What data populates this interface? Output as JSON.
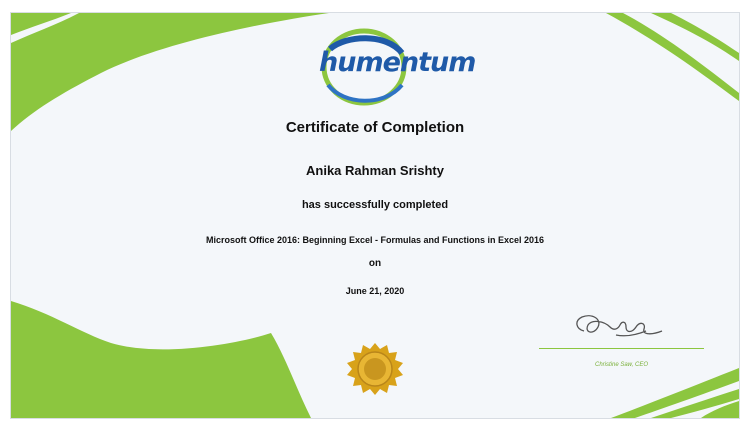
{
  "certificate": {
    "title": "Certificate of Completion",
    "recipient": "Anika Rahman Srishty",
    "completed_text": "has successfully completed",
    "course": "Microsoft Office 2016: Beginning Excel - Formulas and Functions in Excel 2016",
    "on_text": "on",
    "date": "June 21, 2020",
    "signer": "Christine Saw, CEO"
  },
  "logo": {
    "text": "humentum"
  },
  "colors": {
    "accent_green": "#8cc63f",
    "logo_blue": "#1f5aa8",
    "seal_gold": "#d8a21a",
    "background": "#f4f7fa"
  }
}
